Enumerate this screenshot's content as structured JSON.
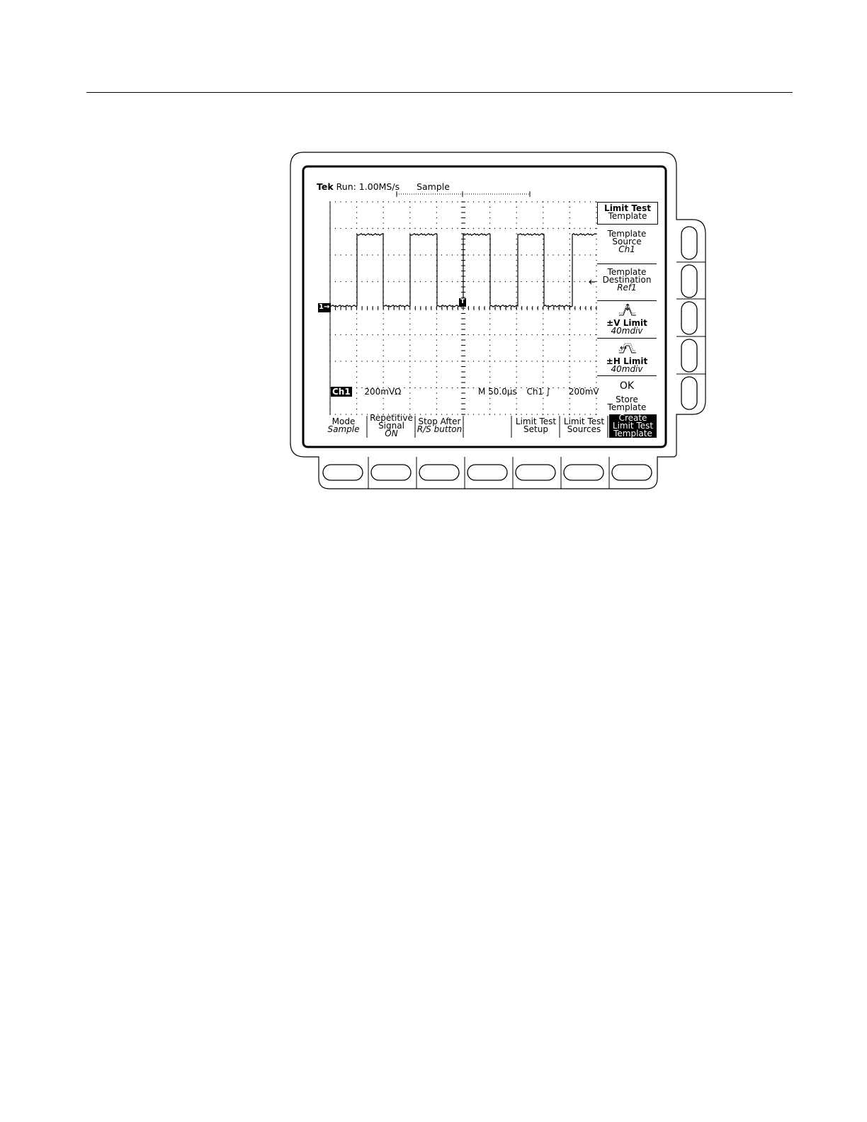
{
  "status": {
    "brand": "Tek",
    "run": "Run: 1.00MS/s",
    "mode": "Sample"
  },
  "readout": {
    "channel": "Ch1",
    "volts_div": "200mVΩ",
    "timebase": "M 50.0µs",
    "trigger_source": "Ch1",
    "trigger_level": "200mV"
  },
  "markers": {
    "ch1_ground": "1→",
    "trigger_point": "T"
  },
  "side_menu": {
    "title_line1": "Limit Test",
    "title_line2": "Template",
    "items": [
      {
        "line1": "Template",
        "line2": "Source",
        "value": "Ch1"
      },
      {
        "line1": "Template",
        "line2": "Destination",
        "value": "Ref1"
      },
      {
        "line1": "±V Limit",
        "value": "40mdiv"
      },
      {
        "line1": "±H Limit",
        "value": "40mdiv"
      },
      {
        "big": "OK",
        "line1": "Store",
        "line2": "Template"
      }
    ]
  },
  "bottom_menu": [
    {
      "line1": "Mode",
      "value": "Sample"
    },
    {
      "line1": "Repetitive",
      "line2": "Signal",
      "value": "ON"
    },
    {
      "line1": "Stop After",
      "value": "R/S button"
    },
    {
      "line1": ""
    },
    {
      "line1": "Limit Test",
      "line2": "Setup"
    },
    {
      "line1": "Limit Test",
      "line2": "Sources"
    },
    {
      "line1": "Create",
      "line2": "Limit Test",
      "line3": "Template"
    }
  ],
  "icons": {
    "v_limit": "v-limit-icon",
    "h_limit": "h-limit-icon"
  }
}
